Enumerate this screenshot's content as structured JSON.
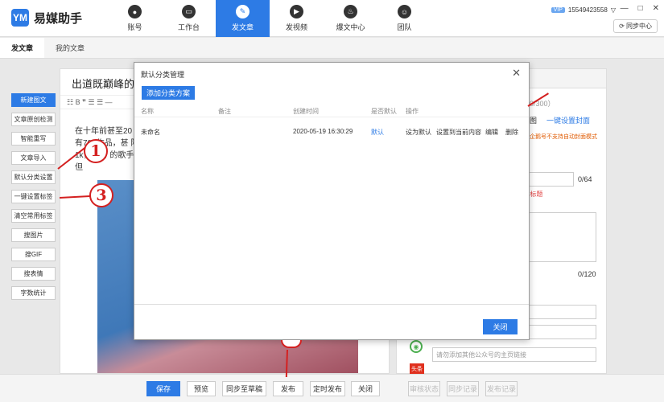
{
  "app": {
    "logo_mark": "YM",
    "name": "易媒助手"
  },
  "nav": [
    {
      "label": "账号",
      "icon": "user-icon",
      "glyph": "●"
    },
    {
      "label": "工作台",
      "icon": "monitor-icon",
      "glyph": "▭"
    },
    {
      "label": "发文章",
      "icon": "compass-icon",
      "glyph": "✎"
    },
    {
      "label": "发视频",
      "icon": "play-icon",
      "glyph": "▶"
    },
    {
      "label": "爆文中心",
      "icon": "flame-icon",
      "glyph": "♨"
    },
    {
      "label": "团队",
      "icon": "team-icon",
      "glyph": "☺"
    }
  ],
  "user": {
    "vip": "VIP",
    "phone": "15549423558",
    "dropdown": "▽"
  },
  "window": {
    "minimize": "—",
    "maximize": "□",
    "close": "✕"
  },
  "sync_label": "同步中心",
  "tabs": [
    "发文章",
    "我的文章"
  ],
  "sidebar": [
    "新建图文",
    "文章原创检测",
    "智能重写",
    "文章导入",
    "默认分类设置",
    "一键设置标签",
    "清空常用标签",
    "搜图片",
    "搜GIF",
    "搜表情",
    "字数统计"
  ],
  "editor": {
    "title": "出道既巅峰的4",
    "toolbar": "☷  B  ❞  ☰  ☰  —",
    "text": "在十年前甚至20 少有700作品，甚 阿到1k，当时 的歌手，但"
  },
  "right_panel": {
    "count": "0/300）",
    "cover_label": "图",
    "one_click_cover": "一键设置封面",
    "warning": "企鹅号不支持自动封面模式",
    "title_limit": "0/64",
    "title_hint": "A标题",
    "summary_limit": "0/120",
    "link_placeholder": "请勿添加其他公众号的主页链接",
    "tag_icon_text": "头条"
  },
  "dialog": {
    "title": "默认分类管理",
    "close": "✕",
    "add_button": "添加分类方案",
    "columns": [
      "名称",
      "备注",
      "创建时间",
      "是否默认",
      "操作"
    ],
    "rows": [
      {
        "name": "未命名",
        "note": "",
        "created": "2020-05-19 16:30:29",
        "is_default": "默认",
        "actions": [
          "设为默认",
          "设置到当前内容",
          "编辑",
          "删除"
        ]
      }
    ],
    "close_button": "关闭"
  },
  "bottom": {
    "save": "保存",
    "preview": "预览",
    "sync_draft": "同步至草稿",
    "publish": "发布",
    "schedule": "定时发布",
    "close": "关闭",
    "review_status": "审核状态",
    "sync_record": "同步记录",
    "publish_record": "发布记录"
  },
  "callouts": [
    "1",
    "3"
  ],
  "colors": {
    "accent": "#2d7be5",
    "callout": "#d42020",
    "warning": "#e05a00"
  }
}
